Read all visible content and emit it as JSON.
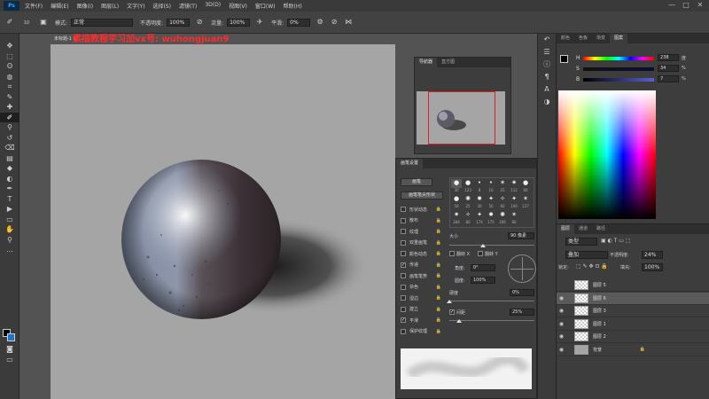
{
  "app": {
    "logo": "Ps"
  },
  "menu": [
    "文件(F)",
    "编辑(E)",
    "图像(I)",
    "图层(L)",
    "文字(Y)",
    "选择(S)",
    "滤镜(T)",
    "3D(D)",
    "视图(V)",
    "窗口(W)",
    "帮助(H)"
  ],
  "window_controls": [
    "—",
    "□",
    "✕"
  ],
  "options_bar": {
    "brush_size": "10",
    "mode_label": "模式:",
    "mode_value": "正常",
    "opacity_label": "不透明度:",
    "opacity_value": "100%",
    "flow_label": "流量:",
    "flow_value": "100%",
    "smooth_label": "平滑:",
    "smooth_value": "0%"
  },
  "document": {
    "tab_label": "未标题-1 @ ...",
    "watermark": "素描教程学习加vx号: wuhongjuan9"
  },
  "tools": [
    "move-tool",
    "marquee-tool",
    "lasso-tool",
    "quick-select-tool",
    "crop-tool",
    "eyedropper-tool",
    "healing-tool",
    "brush-tool",
    "stamp-tool",
    "history-brush-tool",
    "eraser-tool",
    "gradient-tool",
    "blur-tool",
    "dodge-tool",
    "pen-tool",
    "type-tool",
    "path-select-tool",
    "shape-tool",
    "hand-tool",
    "zoom-tool",
    "more-tools"
  ],
  "tool_glyphs": [
    "✥",
    "⬚",
    "ʘ",
    "◍",
    "⌗",
    "✎",
    "✚",
    "✐",
    "⚲",
    "↺",
    "⌫",
    "▤",
    "◆",
    "◐",
    "✒",
    "T",
    "▶",
    "▭",
    "✋",
    "⚲",
    "…"
  ],
  "navigator": {
    "tabs": [
      "导航器",
      "直方图"
    ]
  },
  "brush_settings": {
    "title": "画笔设置",
    "brushes_button": "画笔",
    "tip_shape_button": "画笔笔尖形状",
    "options": [
      {
        "label": "形状动态",
        "checked": false
      },
      {
        "label": "散布",
        "checked": false
      },
      {
        "label": "纹理",
        "checked": false
      },
      {
        "label": "双重画笔",
        "checked": false
      },
      {
        "label": "颜色动态",
        "checked": false
      },
      {
        "label": "传递",
        "checked": true
      },
      {
        "label": "画笔笔势",
        "checked": false
      },
      {
        "label": "杂色",
        "checked": false
      },
      {
        "label": "湿边",
        "checked": false
      },
      {
        "label": "建立",
        "checked": false
      },
      {
        "label": "平滑",
        "checked": true
      },
      {
        "label": "保护纹理",
        "checked": false
      }
    ],
    "tip_sizes": [
      "30",
      "123",
      "8",
      "10",
      "25",
      "112",
      "60",
      "50",
      "25",
      "30",
      "50",
      "60",
      "100",
      "127",
      "284",
      "80",
      "174",
      "175",
      "306",
      "80"
    ],
    "size_label": "大小",
    "size_value": "90 像素",
    "flip_x": "翻转 X",
    "flip_y": "翻转 Y",
    "angle_label": "角度:",
    "angle_value": "0°",
    "roundness_label": "圆度:",
    "roundness_value": "100%",
    "hardness_label": "硬度",
    "hardness_value": "0%",
    "spacing_label": "间距",
    "spacing_value": "25%"
  },
  "right_strip_icons": [
    "history-icon",
    "properties-icon",
    "info-icon",
    "paragraph-icon",
    "character-icon",
    "adjustments-icon"
  ],
  "color_panel": {
    "tabs": [
      "颜色",
      "色板",
      "渐变",
      "图案"
    ],
    "sliders": [
      {
        "label": "H",
        "value": "238",
        "unit": "度"
      },
      {
        "label": "S",
        "value": "34",
        "unit": "%"
      },
      {
        "label": "B",
        "value": "7",
        "unit": "%"
      }
    ]
  },
  "layers_panel": {
    "tabs": [
      "图层",
      "通道",
      "路径"
    ],
    "kind_filter": "类型",
    "blend_mode": "叠加",
    "opacity_label": "不透明度:",
    "opacity_value": "24%",
    "lock_label": "锁定:",
    "fill_label": "填充:",
    "fill_value": "100%",
    "layers": [
      {
        "name": "图层 5",
        "visible": false,
        "selected": false,
        "thumb": "transparent"
      },
      {
        "name": "图层 6",
        "visible": true,
        "selected": true,
        "thumb": "transparent"
      },
      {
        "name": "图层 3",
        "visible": true,
        "selected": false,
        "thumb": "transparent"
      },
      {
        "name": "图层 1",
        "visible": true,
        "selected": false,
        "thumb": "transparent"
      },
      {
        "name": "图层 2",
        "visible": true,
        "selected": false,
        "thumb": "transparent"
      },
      {
        "name": "背景",
        "visible": true,
        "selected": false,
        "thumb": "gray"
      }
    ]
  }
}
